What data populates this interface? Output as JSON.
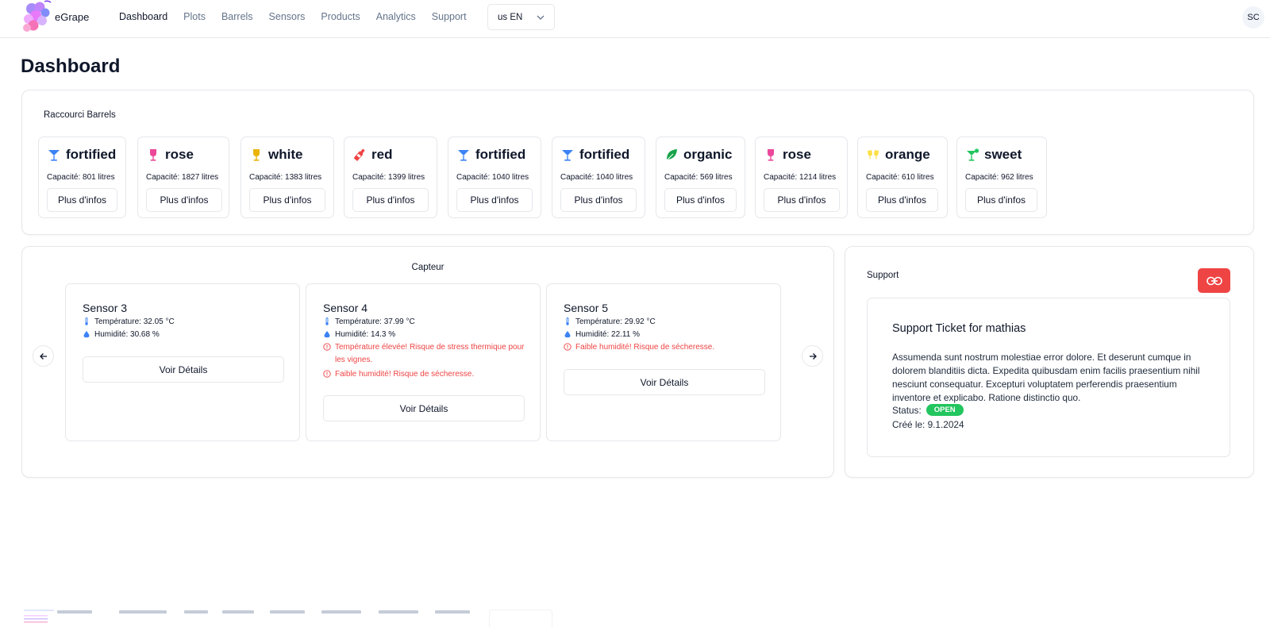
{
  "nav": {
    "brand": "eGrape",
    "links": [
      {
        "label": "Dashboard",
        "active": true
      },
      {
        "label": "Plots",
        "active": false
      },
      {
        "label": "Barrels",
        "active": false
      },
      {
        "label": "Sensors",
        "active": false
      },
      {
        "label": "Products",
        "active": false
      },
      {
        "label": "Analytics",
        "active": false
      },
      {
        "label": "Support",
        "active": false
      }
    ],
    "language": "us EN",
    "user_initials": "SC"
  },
  "page": {
    "title": "Dashboard"
  },
  "barrels": {
    "title": "Raccourci Barrels",
    "button_label": "Plus d'infos",
    "items": [
      {
        "name": "fortified",
        "capacity": "Capacité: 801 litres",
        "icon": "cocktail-glass-icon",
        "color": "#3b82f6"
      },
      {
        "name": "rose",
        "capacity": "Capacité: 1827 litres",
        "icon": "wine-glass-icon",
        "color": "#ec4899"
      },
      {
        "name": "white",
        "capacity": "Capacité: 1383 litres",
        "icon": "wine-glass-icon",
        "color": "#eab308"
      },
      {
        "name": "red",
        "capacity": "Capacité: 1399 litres",
        "icon": "wine-bottle-icon",
        "color": "#ef4444"
      },
      {
        "name": "fortified",
        "capacity": "Capacité: 1040 litres",
        "icon": "cocktail-glass-icon",
        "color": "#3b82f6"
      },
      {
        "name": "fortified",
        "capacity": "Capacité: 1040 litres",
        "icon": "cocktail-glass-icon",
        "color": "#3b82f6"
      },
      {
        "name": "organic",
        "capacity": "Capacité: 569 litres",
        "icon": "leaf-icon",
        "color": "#16a34a"
      },
      {
        "name": "rose",
        "capacity": "Capacité: 1214 litres",
        "icon": "wine-glass-icon",
        "color": "#ec4899"
      },
      {
        "name": "orange",
        "capacity": "Capacité: 610 litres",
        "icon": "glasses-cheers-icon",
        "color": "#fde047"
      },
      {
        "name": "sweet",
        "capacity": "Capacité: 962 litres",
        "icon": "martini-icon",
        "color": "#22c55e"
      }
    ]
  },
  "capteur": {
    "title": "Capteur",
    "button_label": "Voir Détails",
    "sensors": [
      {
        "name": "Sensor 3",
        "temperature": "Température: 32.05 °C",
        "humidity": "Humidité: 30.68 %",
        "warnings": []
      },
      {
        "name": "Sensor 4",
        "temperature": "Température: 37.99 °C",
        "humidity": "Humidité: 14.3 %",
        "warnings": [
          "Température élevée! Risque de stress thermique pour les vignes.",
          "Faible humidité! Risque de sécheresse."
        ]
      },
      {
        "name": "Sensor 5",
        "temperature": "Température: 29.92 °C",
        "humidity": "Humidité: 22.11 %",
        "warnings": [
          "Faible humidité! Risque de sécheresse."
        ]
      }
    ]
  },
  "support": {
    "title": "Support",
    "ticket": {
      "title": "Support Ticket for mathias",
      "body": "Assumenda sunt nostrum molestiae error dolore. Et deserunt cumque in dolorem blanditiis dicta. Expedita quibusdam enim facilis praesentium nihil nesciunt consequatur. Excepturi voluptatem perferendis praesentium inventore et explicabo. Ratione distinctio quo.",
      "status_label": "Status:",
      "status": "OPEN",
      "created": "Créé le: 9.1.2024"
    }
  },
  "colors": {
    "accent_red": "#ef4444",
    "status_green": "#22c55e",
    "border": "#e5e7eb",
    "muted": "#64748b"
  }
}
